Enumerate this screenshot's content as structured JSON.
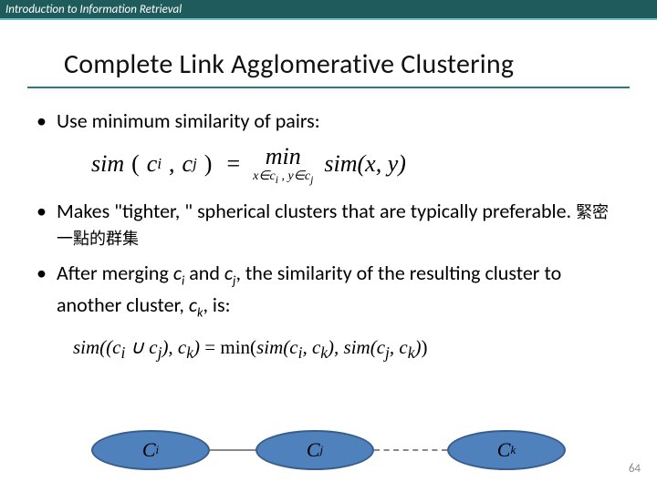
{
  "header": {
    "course": "Introduction to Information Retrieval"
  },
  "title": "Complete Link Agglomerative Clustering",
  "bullets": {
    "b1": "Use minimum similarity of pairs:",
    "b2a": "Makes \"tighter, \" spherical clusters that are typically preferable. ",
    "b2b": "緊密一點的群集",
    "b3a": "After merging ",
    "b3b": " and ",
    "b3c": ", the similarity of the resulting cluster to another cluster, ",
    "b3d": ", is:"
  },
  "math": {
    "sim": "sim",
    "ci": "c",
    "ci_sub": "i",
    "cj": "c",
    "cj_sub": "j",
    "ck": "c",
    "ck_sub": "k",
    "eq": "=",
    "min": "min",
    "min_sub": "x∈c_i , y∈c_j",
    "xy": "sim(x, y)",
    "f2": "sim((c_i ∪ c_j), c_k) = min(sim(c_i, c_k), sim(c_j, c_k))"
  },
  "nodes": {
    "Ci": "C",
    "Ci_sub": "i",
    "Cj": "C",
    "Cj_sub": "j",
    "Ck": "C",
    "Ck_sub": "k"
  },
  "page": "64"
}
